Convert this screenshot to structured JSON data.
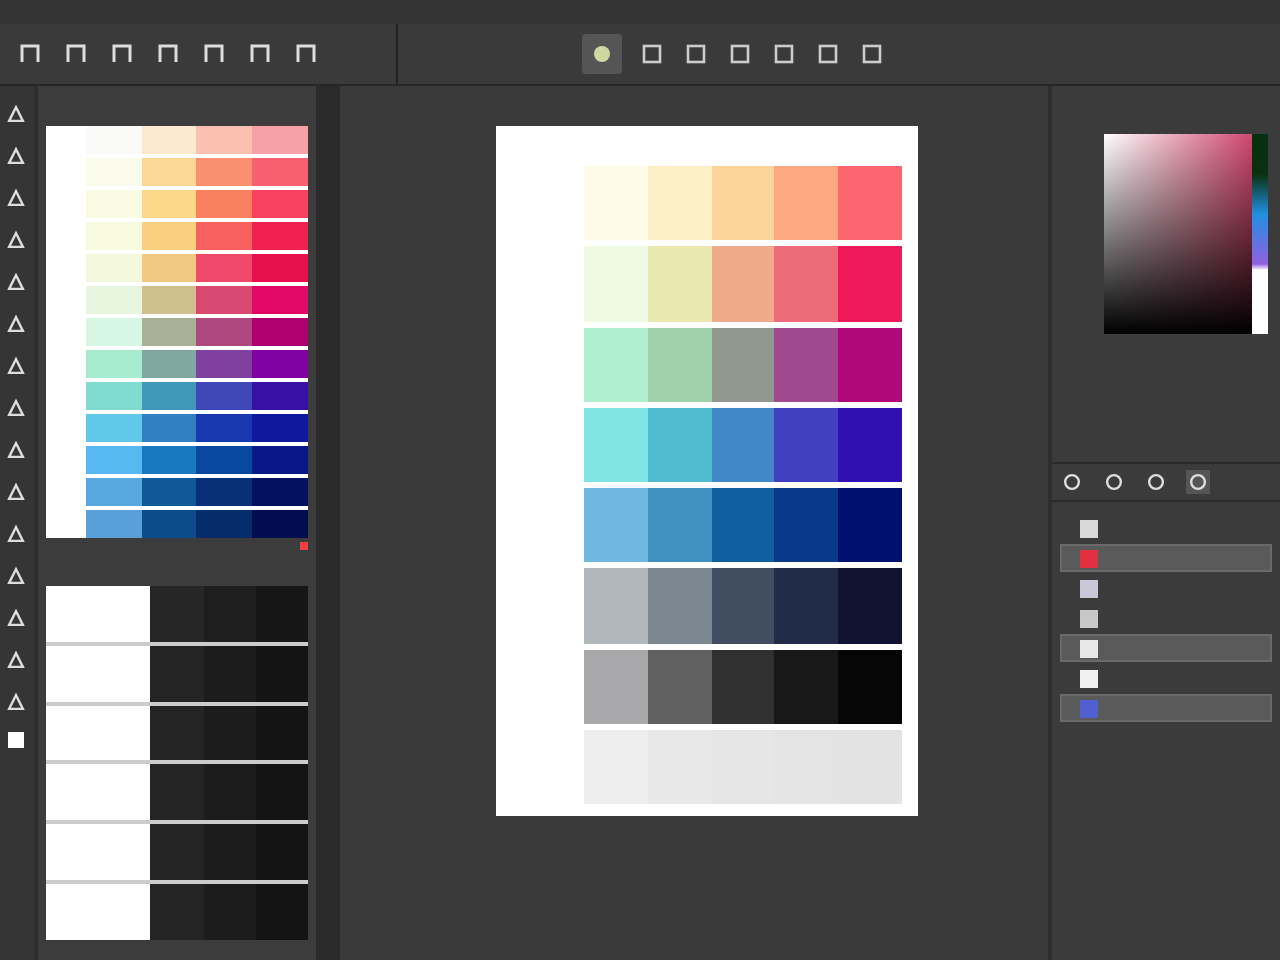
{
  "swatch_panel": {
    "rows": [
      {
        "swatches": [
          {
            "color": "#fafaf8"
          },
          {
            "color": "#fde8d0"
          },
          {
            "color": "#fbc0b0"
          },
          {
            "color": "#f8a0a8"
          }
        ]
      },
      {
        "swatches": [
          {
            "color": "#fbfbec"
          },
          {
            "color": "#fcd896"
          },
          {
            "color": "#fa9070"
          },
          {
            "color": "#f86070"
          }
        ]
      },
      {
        "swatches": [
          {
            "color": "#fbfbe4"
          },
          {
            "color": "#fcd888"
          },
          {
            "color": "#fa8060"
          },
          {
            "color": "#f84060"
          }
        ]
      },
      {
        "swatches": [
          {
            "color": "#f8fae0"
          },
          {
            "color": "#f8d080"
          },
          {
            "color": "#f86060"
          },
          {
            "color": "#f02050"
          }
        ]
      },
      {
        "swatches": [
          {
            "color": "#f4f8dc"
          },
          {
            "color": "#f0c880"
          },
          {
            "color": "#f04868"
          },
          {
            "color": "#e8104c"
          }
        ]
      },
      {
        "swatches": [
          {
            "color": "#e8f6e0"
          },
          {
            "color": "#d0c090"
          },
          {
            "color": "#d84870"
          },
          {
            "color": "#e00868"
          }
        ]
      },
      {
        "swatches": [
          {
            "color": "#d8f6e4"
          },
          {
            "color": "#a8b098"
          },
          {
            "color": "#b04880"
          },
          {
            "color": "#b00070"
          }
        ]
      },
      {
        "swatches": [
          {
            "color": "#a8ecd0"
          },
          {
            "color": "#80a8a0"
          },
          {
            "color": "#8040a0"
          },
          {
            "color": "#8000a0"
          }
        ]
      },
      {
        "swatches": [
          {
            "color": "#80dcd0"
          },
          {
            "color": "#4098b8"
          },
          {
            "color": "#4048b8"
          },
          {
            "color": "#3810a8"
          }
        ]
      },
      {
        "swatches": [
          {
            "color": "#60c8e8"
          },
          {
            "color": "#3080c0"
          },
          {
            "color": "#1838b0"
          },
          {
            "color": "#1018a0"
          }
        ]
      },
      {
        "swatches": [
          {
            "color": "#58b8f0"
          },
          {
            "color": "#1878c0"
          },
          {
            "color": "#0848a0"
          },
          {
            "color": "#081888"
          }
        ]
      },
      {
        "swatches": [
          {
            "color": "#58a8e0"
          },
          {
            "color": "#105898"
          },
          {
            "color": "#083078"
          },
          {
            "color": "#041060"
          }
        ]
      },
      {
        "swatches": [
          {
            "color": "#5aa0d8"
          },
          {
            "color": "#0c4c8c"
          },
          {
            "color": "#062c6c"
          },
          {
            "color": "#040c50"
          }
        ]
      }
    ]
  },
  "gray_panel": {
    "rows": [
      {
        "swatches": [
          {
            "color": "#ffffff"
          },
          {
            "color": "#262626"
          },
          {
            "color": "#1e1e1e"
          },
          {
            "color": "#161616"
          }
        ]
      },
      {
        "swatches": [
          {
            "color": "#ffffff"
          },
          {
            "color": "#242424"
          },
          {
            "color": "#1c1c1c"
          },
          {
            "color": "#141414"
          }
        ]
      },
      {
        "swatches": [
          {
            "color": "#ffffff"
          },
          {
            "color": "#242424"
          },
          {
            "color": "#1c1c1c"
          },
          {
            "color": "#141414"
          }
        ]
      },
      {
        "swatches": [
          {
            "color": "#ffffff"
          },
          {
            "color": "#242424"
          },
          {
            "color": "#1c1c1c"
          },
          {
            "color": "#141414"
          }
        ]
      },
      {
        "swatches": [
          {
            "color": "#ffffff"
          },
          {
            "color": "#242424"
          },
          {
            "color": "#1c1c1c"
          },
          {
            "color": "#141414"
          }
        ]
      },
      {
        "swatches": [
          {
            "color": "#ffffff"
          },
          {
            "color": "#242424"
          },
          {
            "color": "#1c1c1c"
          },
          {
            "color": "#141414"
          }
        ]
      }
    ]
  },
  "document": {
    "rows": [
      {
        "swatches": [
          {
            "color": "#fdfbe8"
          },
          {
            "color": "#fdf0c6"
          },
          {
            "color": "#fdd59a"
          },
          {
            "color": "#fda880"
          },
          {
            "color": "#fb6670"
          }
        ]
      },
      {
        "swatches": [
          {
            "color": "#eef9e4"
          },
          {
            "color": "#e8e8b0"
          },
          {
            "color": "#eeaa8a"
          },
          {
            "color": "#ec6a7a"
          },
          {
            "color": "#ee1a5a"
          }
        ]
      },
      {
        "swatches": [
          {
            "color": "#b0f0d0"
          },
          {
            "color": "#a0d0a8"
          },
          {
            "color": "#909890"
          },
          {
            "color": "#a04890"
          },
          {
            "color": "#b00878"
          }
        ]
      },
      {
        "swatches": [
          {
            "color": "#80e4e4"
          },
          {
            "color": "#50bcd0"
          },
          {
            "color": "#4088c8"
          },
          {
            "color": "#4040c0"
          },
          {
            "color": "#3010b0"
          }
        ]
      },
      {
        "swatches": [
          {
            "color": "#70b8e0"
          },
          {
            "color": "#4090c0"
          },
          {
            "color": "#1060a0"
          },
          {
            "color": "#083888"
          },
          {
            "color": "#001070"
          }
        ]
      },
      {
        "swatches": [
          {
            "color": "#b0b8bc"
          },
          {
            "color": "#7c8890"
          },
          {
            "color": "#404c60"
          },
          {
            "color": "#202c48"
          },
          {
            "color": "#101430"
          }
        ]
      },
      {
        "swatches": [
          {
            "color": "#a8a8aa"
          },
          {
            "color": "#606060"
          },
          {
            "color": "#303030"
          },
          {
            "color": "#181818"
          },
          {
            "color": "#060606"
          }
        ]
      },
      {
        "swatches": [
          {
            "color": "#eeeeee"
          },
          {
            "color": "#e8e8e8"
          },
          {
            "color": "#e6e6e6"
          },
          {
            "color": "#e4e4e4"
          },
          {
            "color": "#e3e3e3"
          }
        ]
      }
    ]
  },
  "layers": [
    {
      "color": "#d8d8d8",
      "selected": false
    },
    {
      "color": "#e03040",
      "selected": true
    },
    {
      "color": "#c8c8d8",
      "selected": false
    },
    {
      "color": "#c8c8c8",
      "selected": false
    },
    {
      "color": "#e8e8e8",
      "selected": true
    },
    {
      "color": "#f0f0f0",
      "selected": false
    },
    {
      "color": "#5060d0",
      "selected": true
    }
  ]
}
